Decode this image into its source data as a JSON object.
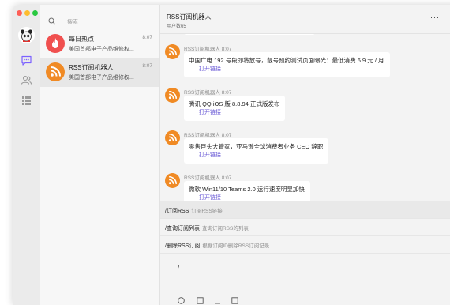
{
  "sidebar": {
    "icons": [
      "app-avatar",
      "chat-icon",
      "contacts-icon",
      "apps-grid-icon"
    ]
  },
  "search": {
    "placeholder": "搜索"
  },
  "conversations": [
    {
      "name": "每日热点",
      "time": "8:07",
      "preview": "美国首部电子产品维修权..."
    },
    {
      "name": "RSS订阅机器人",
      "time": "8:07",
      "preview": "美国首部电子产品维修权..."
    }
  ],
  "chat": {
    "title": "RSS订阅机器人",
    "subtitle": "用户数65",
    "more": "···"
  },
  "messages": [
    {
      "sender": "RSS订阅机器人",
      "time": "8:07",
      "text": "中国广电 192 号段即将放号，靓号预约测试页面曝光：最低消费 6.9 元 / 月",
      "link": "打开链接"
    },
    {
      "sender": "RSS订阅机器人",
      "time": "8:07",
      "text": "腾讯 QQ iOS 版 8.8.94 正式版发布",
      "link": "打开链接"
    },
    {
      "sender": "RSS订阅机器人",
      "time": "8:07",
      "text": "零售巨头大管家，亚马逊全球消费者业务 CEO 辞职",
      "link": "打开链接"
    },
    {
      "sender": "RSS订阅机器人",
      "time": "8:07",
      "text": "微软 Win11/10 Teams 2.0 运行速度明显加快",
      "link": "打开链接"
    }
  ],
  "commands": [
    {
      "cmd": "/订阅RSS",
      "desc": "订阅RSS链接"
    },
    {
      "cmd": "/查询订阅列表",
      "desc": "查询订阅RSS的列表"
    },
    {
      "cmd": "/删除RSS订阅",
      "desc": "根据订阅ID删除RSS订阅记录"
    }
  ],
  "input": {
    "value": "/"
  },
  "colors": {
    "rss_orange": "#f08a24",
    "fire_red": "#f0504f",
    "link": "#6b5bd6",
    "accent_purple": "#7b61ff"
  }
}
